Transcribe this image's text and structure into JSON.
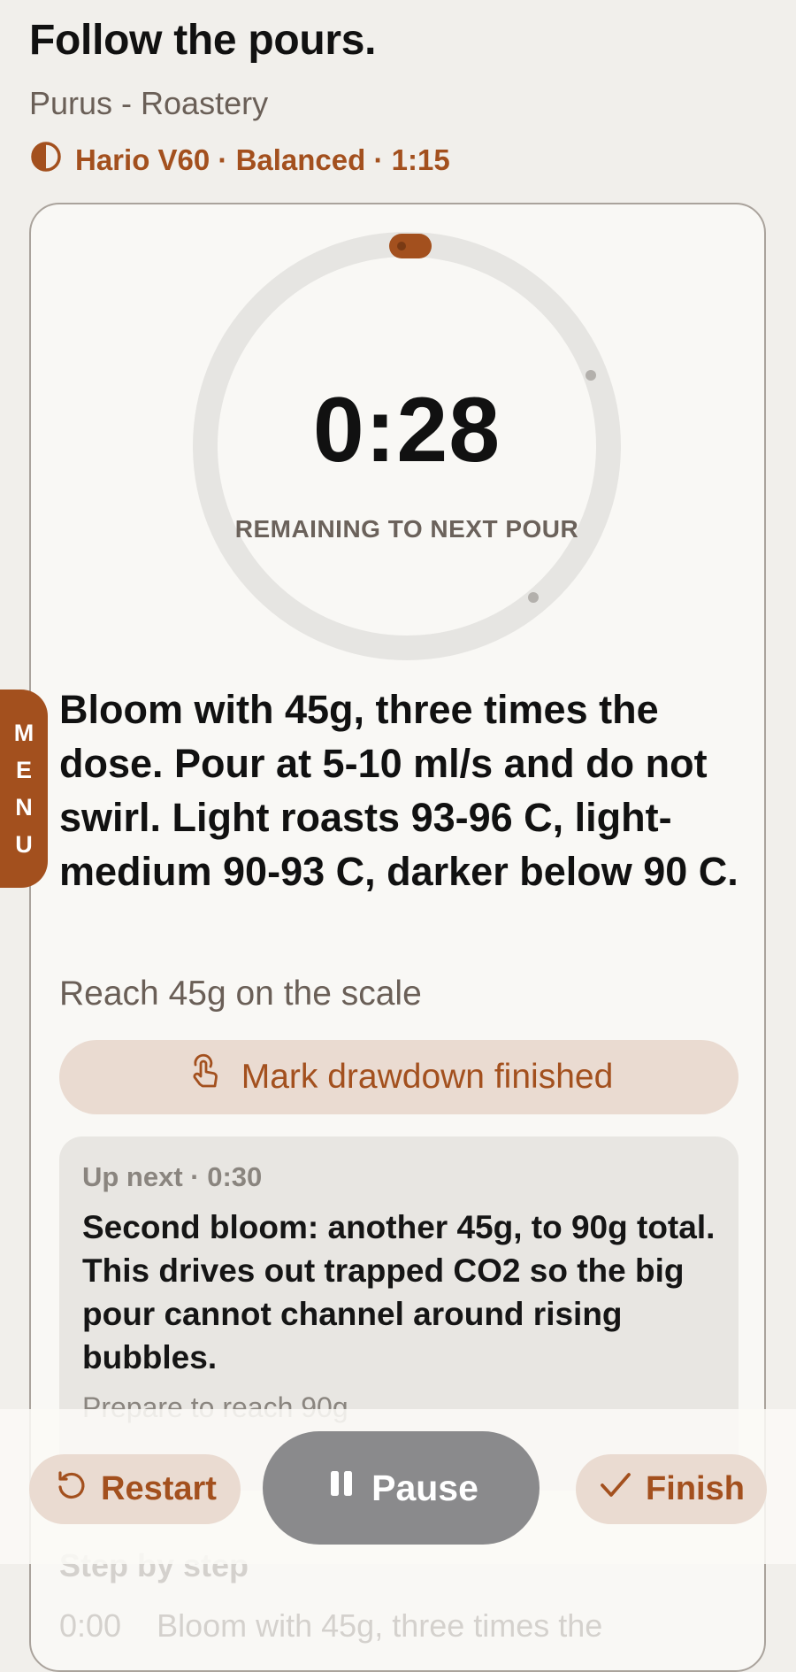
{
  "header": {
    "title": "Follow the pours.",
    "coffee": "Purus - Roastery",
    "brew_summary": "Hario V60 · Balanced · 1:15"
  },
  "timer": {
    "value": "0:28",
    "label": "REMAINING TO NEXT POUR"
  },
  "current_step": {
    "instruction": "Bloom with 45g, three times the dose. Pour at 5-10 ml/s and do not swirl. Light roasts 93-96 C, light-medium 90-93 C, darker below 90 C.",
    "target": "Reach 45g on the scale",
    "drawdown_label": "Mark drawdown finished"
  },
  "up_next": {
    "header": "Up next · 0:30",
    "instruction": "Second bloom: another 45g, to 90g total. This drives out trapped CO2 so the big pour cannot channel around rising bubbles.",
    "target": "Prepare to reach 90g"
  },
  "steps_section": {
    "title": "Step by step",
    "first_time": "0:00",
    "first_text": "Bloom with 45g, three times the"
  },
  "menu": {
    "letters": [
      "M",
      "E",
      "N",
      "U"
    ]
  },
  "controls": {
    "restart": "Restart",
    "pause": "Pause",
    "finish": "Finish"
  },
  "colors": {
    "accent": "#a3501e",
    "accent_soft": "#eadbd1",
    "background": "#f1efeb",
    "card": "#f9f8f5",
    "pause_button": "#8a8a8c"
  },
  "icons": {
    "brew_method": "half-circle-icon",
    "drawdown": "tap-hand-icon",
    "restart": "restart-icon",
    "pause": "pause-icon",
    "finish": "checkmark-icon"
  }
}
